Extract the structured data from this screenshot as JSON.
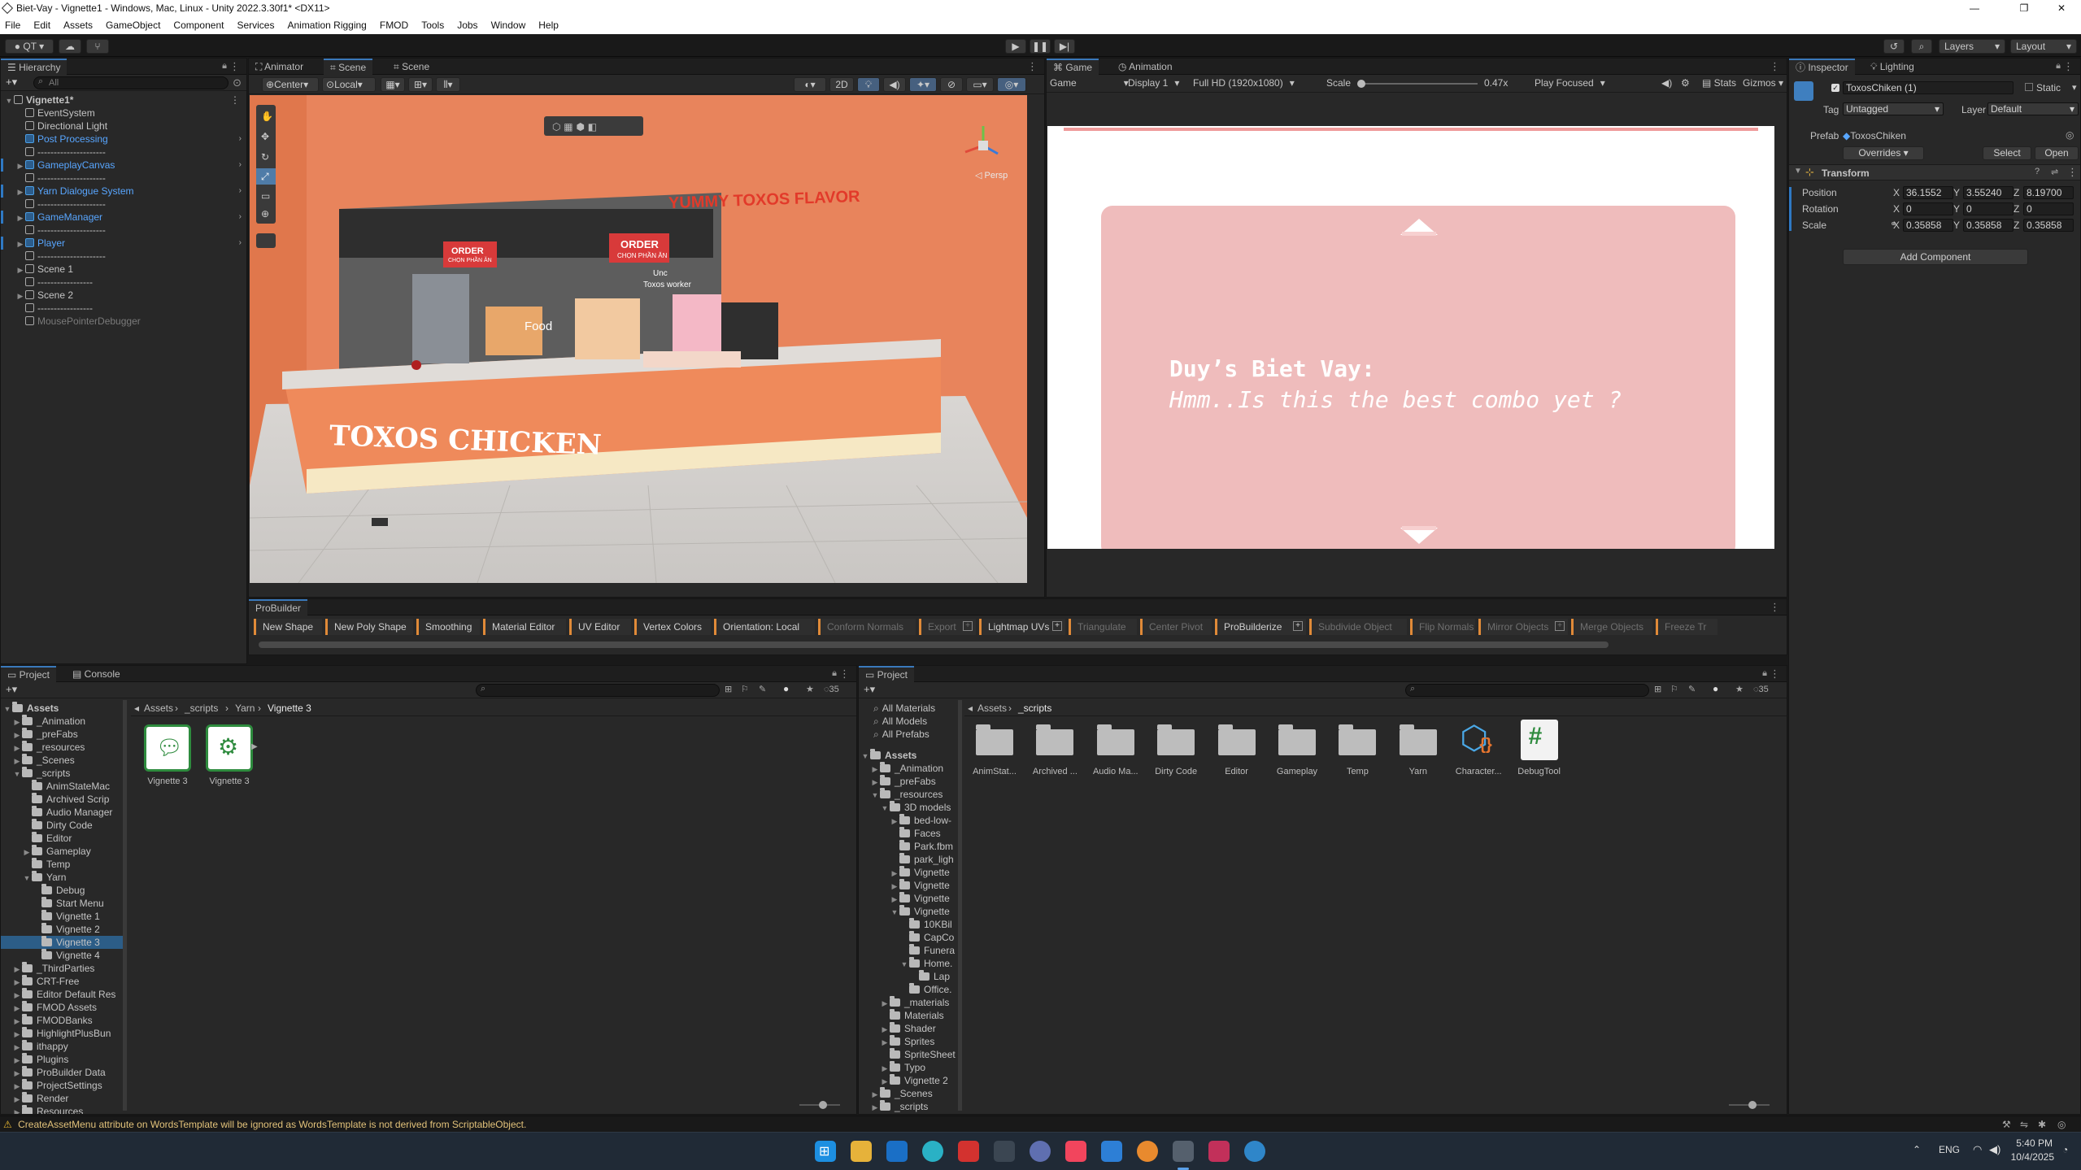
{
  "window": {
    "title": "Biet-Vay - Vignette1 - Windows, Mac, Linux - Unity 2022.3.30f1* <DX11>",
    "minimize": "—",
    "maximize": "❐",
    "close": "✕"
  },
  "menu": [
    "File",
    "Edit",
    "Assets",
    "GameObject",
    "Component",
    "Services",
    "Animation Rigging",
    "FMOD",
    "Tools",
    "Jobs",
    "Window",
    "Help"
  ],
  "toolbar": {
    "account": "QT",
    "layers": "Layers",
    "layout": "Layout"
  },
  "hierarchy": {
    "tab": "Hierarchy",
    "search_placeholder": "All",
    "rows": [
      {
        "label": "Vignette1*",
        "indent": 0,
        "tri": "▼",
        "bold": true,
        "icon": "unity"
      },
      {
        "label": "EventSystem",
        "indent": 1,
        "icon": "cube"
      },
      {
        "label": "Directional Light",
        "indent": 1,
        "icon": "cube"
      },
      {
        "label": "Post Processing",
        "indent": 1,
        "icon": "blue",
        "blue": true,
        "arrow": true
      },
      {
        "label": "---------------------",
        "indent": 1,
        "icon": "cube"
      },
      {
        "label": "GameplayCanvas",
        "indent": 1,
        "icon": "blue",
        "blue": true,
        "tri": "▶",
        "arrow": true,
        "bar": true
      },
      {
        "label": "---------------------",
        "indent": 1,
        "icon": "cube"
      },
      {
        "label": "Yarn Dialogue System",
        "indent": 1,
        "icon": "blue",
        "blue": true,
        "tri": "▶",
        "arrow": true,
        "bar": true
      },
      {
        "label": "---------------------",
        "indent": 1,
        "icon": "cube"
      },
      {
        "label": "GameManager",
        "indent": 1,
        "icon": "blue",
        "blue": true,
        "tri": "▶",
        "arrow": true,
        "bar": true
      },
      {
        "label": "---------------------",
        "indent": 1,
        "icon": "cube"
      },
      {
        "label": "Player",
        "indent": 1,
        "icon": "blue",
        "blue": true,
        "tri": "▶",
        "arrow": true,
        "bar": true
      },
      {
        "label": "---------------------",
        "indent": 1,
        "icon": "cube"
      },
      {
        "label": "Scene 1",
        "indent": 1,
        "icon": "cube",
        "tri": "▶"
      },
      {
        "label": "-----------------",
        "indent": 1,
        "icon": "cube"
      },
      {
        "label": "Scene 2",
        "indent": 1,
        "icon": "cube",
        "tri": "▶"
      },
      {
        "label": "-----------------",
        "indent": 1,
        "icon": "cube"
      },
      {
        "label": "MousePointerDebugger",
        "indent": 1,
        "icon": "cube",
        "dim": true
      }
    ]
  },
  "scene": {
    "tabs": [
      "Animator",
      "Scene",
      "Scene"
    ],
    "pivot": "Center",
    "space": "Local",
    "mode2d": "2D",
    "persp": "◁ Persp",
    "sign_yummy": "YUMMY TOXOS FLAVOR",
    "sign_order": "ORDER",
    "sign_order_sub": "CHỌN PHẦN ĂN",
    "sign_worker": "Toxos worker",
    "sign_unc": "Unc",
    "sign_food": "Food",
    "counter_text": "TOXOS CHICKEN"
  },
  "game": {
    "tabs": [
      "Game",
      "Animation"
    ],
    "mode": "Game",
    "display": "Display 1",
    "resolution": "Full HD (1920x1080)",
    "scale_label": "Scale",
    "scale_value": "0.47x",
    "play_focused": "Play Focused",
    "stats": "Stats",
    "gizmos": "Gizmos",
    "dialog_speaker": "Duy’s Biet Vay:",
    "dialog_line": "Hmm..Is this the best combo yet ?"
  },
  "inspector": {
    "tabs": [
      "Inspector",
      "Lighting"
    ],
    "name": "ToxosChiken (1)",
    "static": "Static",
    "tag_label": "Tag",
    "tag": "Untagged",
    "layer_label": "Layer",
    "layer": "Default",
    "prefab_label": "Prefab",
    "prefab": "ToxosChiken",
    "overrides": "Overrides",
    "select": "Select",
    "open": "Open",
    "transform": "Transform",
    "position_label": "Position",
    "pos": [
      "36.1552",
      "3.55240",
      "8.19700"
    ],
    "rotation_label": "Rotation",
    "rot": [
      "0",
      "0",
      "0"
    ],
    "scale_label": "Scale",
    "scl": [
      "0.35858",
      "0.35858",
      "0.35858"
    ],
    "add_component": "Add Component",
    "axes": [
      "X",
      "Y",
      "Z"
    ]
  },
  "probuilder": {
    "tab": "ProBuilder",
    "buttons": [
      {
        "label": "New Shape",
        "on": true
      },
      {
        "label": "New Poly Shape",
        "on": true
      },
      {
        "label": "Smoothing",
        "on": true
      },
      {
        "label": "Material Editor",
        "on": true
      },
      {
        "label": "UV Editor",
        "on": true
      },
      {
        "label": "Vertex Colors",
        "on": true
      },
      {
        "label": "Orientation: Local",
        "on": true
      },
      {
        "label": "Conform Normals",
        "on": false
      },
      {
        "label": "Export",
        "on": false,
        "plus": true
      },
      {
        "label": "Lightmap UVs",
        "on": true,
        "plus": true
      },
      {
        "label": "Triangulate",
        "on": false
      },
      {
        "label": "Center Pivot",
        "on": false
      },
      {
        "label": "ProBuilderize",
        "on": true,
        "plus": true
      },
      {
        "label": "Subdivide Object",
        "on": false
      },
      {
        "label": "Flip Normals",
        "on": false
      },
      {
        "label": "Mirror Objects",
        "on": false,
        "plus": true
      },
      {
        "label": "Merge Objects",
        "on": false
      },
      {
        "label": "Freeze Tr",
        "on": false
      }
    ]
  },
  "project1": {
    "tabs": [
      "Project",
      "Console"
    ],
    "count": "35",
    "breadcrumb": [
      "Assets",
      "_scripts",
      "Yarn",
      "Vignette 3"
    ],
    "tree": [
      {
        "label": "Assets",
        "d": 0,
        "tri": "▼",
        "bold": true
      },
      {
        "label": "_Animation",
        "d": 1,
        "tri": "▶"
      },
      {
        "label": "_preFabs",
        "d": 1,
        "tri": "▶"
      },
      {
        "label": "_resources",
        "d": 1,
        "tri": "▶"
      },
      {
        "label": "_Scenes",
        "d": 1,
        "tri": "▶"
      },
      {
        "label": "_scripts",
        "d": 1,
        "tri": "▼"
      },
      {
        "label": "AnimStateMac",
        "d": 2
      },
      {
        "label": "Archived Scrip",
        "d": 2
      },
      {
        "label": "Audio Manager",
        "d": 2
      },
      {
        "label": "Dirty Code",
        "d": 2
      },
      {
        "label": "Editor",
        "d": 2
      },
      {
        "label": "Gameplay",
        "d": 2,
        "tri": "▶"
      },
      {
        "label": "Temp",
        "d": 2
      },
      {
        "label": "Yarn",
        "d": 2,
        "tri": "▼"
      },
      {
        "label": "Debug",
        "d": 3
      },
      {
        "label": "Start Menu",
        "d": 3
      },
      {
        "label": "Vignette 1",
        "d": 3
      },
      {
        "label": "Vignette 2",
        "d": 3
      },
      {
        "label": "Vignette 3",
        "d": 3,
        "sel": true
      },
      {
        "label": "Vignette 4",
        "d": 3
      },
      {
        "label": "_ThirdParties",
        "d": 1,
        "tri": "▶"
      },
      {
        "label": "CRT-Free",
        "d": 1,
        "tri": "▶"
      },
      {
        "label": "Editor Default Res",
        "d": 1,
        "tri": "▶"
      },
      {
        "label": "FMOD Assets",
        "d": 1,
        "tri": "▶"
      },
      {
        "label": "FMODBanks",
        "d": 1,
        "tri": "▶"
      },
      {
        "label": "HighlightPlusBun",
        "d": 1,
        "tri": "▶"
      },
      {
        "label": "ithappy",
        "d": 1,
        "tri": "▶"
      },
      {
        "label": "Plugins",
        "d": 1,
        "tri": "▶"
      },
      {
        "label": "ProBuilder Data",
        "d": 1,
        "tri": "▶"
      },
      {
        "label": "ProjectSettings",
        "d": 1,
        "tri": "▶"
      },
      {
        "label": "Render",
        "d": 1,
        "tri": "▶"
      },
      {
        "label": "Resources",
        "d": 1,
        "tri": "▶"
      }
    ],
    "items": [
      "Vignette 3",
      "Vignette 3"
    ]
  },
  "project2": {
    "tab": "Project",
    "count": "35",
    "breadcrumb": [
      "Assets",
      "_scripts"
    ],
    "favorites": [
      "All Materials",
      "All Models",
      "All Prefabs"
    ],
    "tree": [
      {
        "label": "Assets",
        "d": 0,
        "tri": "▼",
        "bold": true
      },
      {
        "label": "_Animation",
        "d": 1,
        "tri": "▶"
      },
      {
        "label": "_preFabs",
        "d": 1,
        "tri": "▶"
      },
      {
        "label": "_resources",
        "d": 1,
        "tri": "▼"
      },
      {
        "label": "3D models",
        "d": 2,
        "tri": "▼"
      },
      {
        "label": "bed-low-",
        "d": 3,
        "tri": "▶"
      },
      {
        "label": "Faces",
        "d": 3
      },
      {
        "label": "Park.fbm",
        "d": 3
      },
      {
        "label": "park_ligh",
        "d": 3
      },
      {
        "label": "Vignette",
        "d": 3,
        "tri": "▶"
      },
      {
        "label": "Vignette",
        "d": 3,
        "tri": "▶"
      },
      {
        "label": "Vignette",
        "d": 3,
        "tri": "▶"
      },
      {
        "label": "Vignette",
        "d": 3,
        "tri": "▼"
      },
      {
        "label": "10KBil",
        "d": 4
      },
      {
        "label": "CapCo",
        "d": 4
      },
      {
        "label": "Funera",
        "d": 4
      },
      {
        "label": "Home.",
        "d": 4,
        "tri": "▼"
      },
      {
        "label": "Lap",
        "d": 5
      },
      {
        "label": "Office.",
        "d": 4
      },
      {
        "label": "_materials",
        "d": 2,
        "tri": "▶"
      },
      {
        "label": "Materials",
        "d": 2
      },
      {
        "label": "Shader",
        "d": 2,
        "tri": "▶"
      },
      {
        "label": "Sprites",
        "d": 2,
        "tri": "▶"
      },
      {
        "label": "SpriteSheet",
        "d": 2
      },
      {
        "label": "Typo",
        "d": 2,
        "tri": "▶"
      },
      {
        "label": "Vignette 2",
        "d": 2,
        "tri": "▶"
      },
      {
        "label": "_Scenes",
        "d": 1,
        "tri": "▶"
      },
      {
        "label": "_scripts",
        "d": 1,
        "tri": "▶"
      }
    ],
    "items": [
      {
        "label": "AnimStat...",
        "kind": "folder"
      },
      {
        "label": "Archived ...",
        "kind": "folder"
      },
      {
        "label": "Audio Ma...",
        "kind": "folder"
      },
      {
        "label": "Dirty Code",
        "kind": "folder"
      },
      {
        "label": "Editor",
        "kind": "folder"
      },
      {
        "label": "Gameplay",
        "kind": "folder"
      },
      {
        "label": "Temp",
        "kind": "folder"
      },
      {
        "label": "Yarn",
        "kind": "folder"
      },
      {
        "label": "Character...",
        "kind": "asm"
      },
      {
        "label": "DebugTool",
        "kind": "cs"
      }
    ]
  },
  "status": {
    "warning": "CreateAssetMenu attribute on WordsTemplate will be ignored as WordsTemplate is not derived from ScriptableObject."
  },
  "taskbar": {
    "lang": "ENG",
    "time": "5:40 PM",
    "date": "10/4/2025"
  }
}
